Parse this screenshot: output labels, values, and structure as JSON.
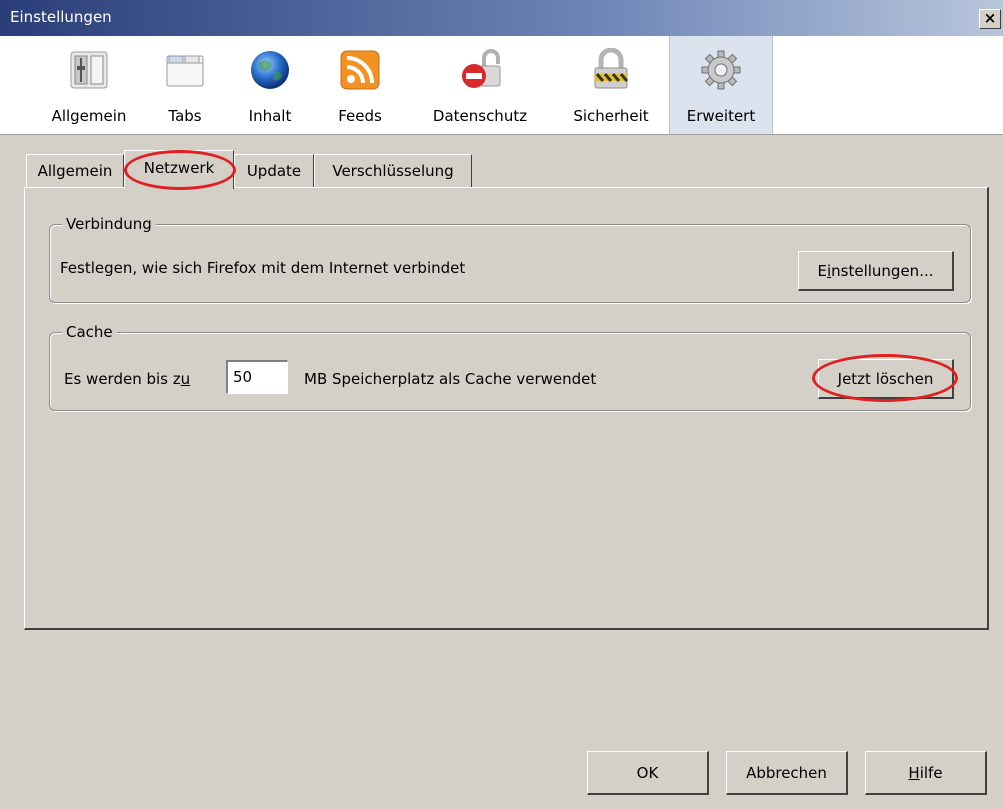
{
  "window": {
    "title": "Einstellungen",
    "close_label": "×"
  },
  "toolbar": {
    "items": [
      {
        "label": "Allgemein",
        "icon": "general-icon"
      },
      {
        "label": "Tabs",
        "icon": "tabs-icon"
      },
      {
        "label": "Inhalt",
        "icon": "globe-icon"
      },
      {
        "label": "Feeds",
        "icon": "rss-icon"
      },
      {
        "label": "Datenschutz",
        "icon": "privacy-icon"
      },
      {
        "label": "Sicherheit",
        "icon": "lock-icon"
      },
      {
        "label": "Erweitert",
        "icon": "gear-icon",
        "selected": true
      }
    ]
  },
  "subtabs": {
    "items": [
      {
        "label": "Allgemein"
      },
      {
        "label": "Netzwerk",
        "active": true
      },
      {
        "label": "Update"
      },
      {
        "label": "Verschlüsselung"
      }
    ]
  },
  "verbindung": {
    "legend": "Verbindung",
    "description": "Festlegen, wie sich Firefox mit dem Internet verbindet",
    "button_pre": "E",
    "button_mnemonic": "i",
    "button_post": "nstellungen..."
  },
  "cache": {
    "legend": "Cache",
    "text_before": "Es werden bis z",
    "text_mnemonic": "u",
    "value": "50",
    "text_after": "MB Speicherplatz als Cache verwendet",
    "clear_button": "Jetzt löschen"
  },
  "footer": {
    "ok": "OK",
    "cancel": "Abbrechen",
    "help_mnemonic": "H",
    "help_rest": "ilfe"
  },
  "colors": {
    "highlight": "#e02020",
    "selected_toolbar": "#dbe3ee"
  }
}
